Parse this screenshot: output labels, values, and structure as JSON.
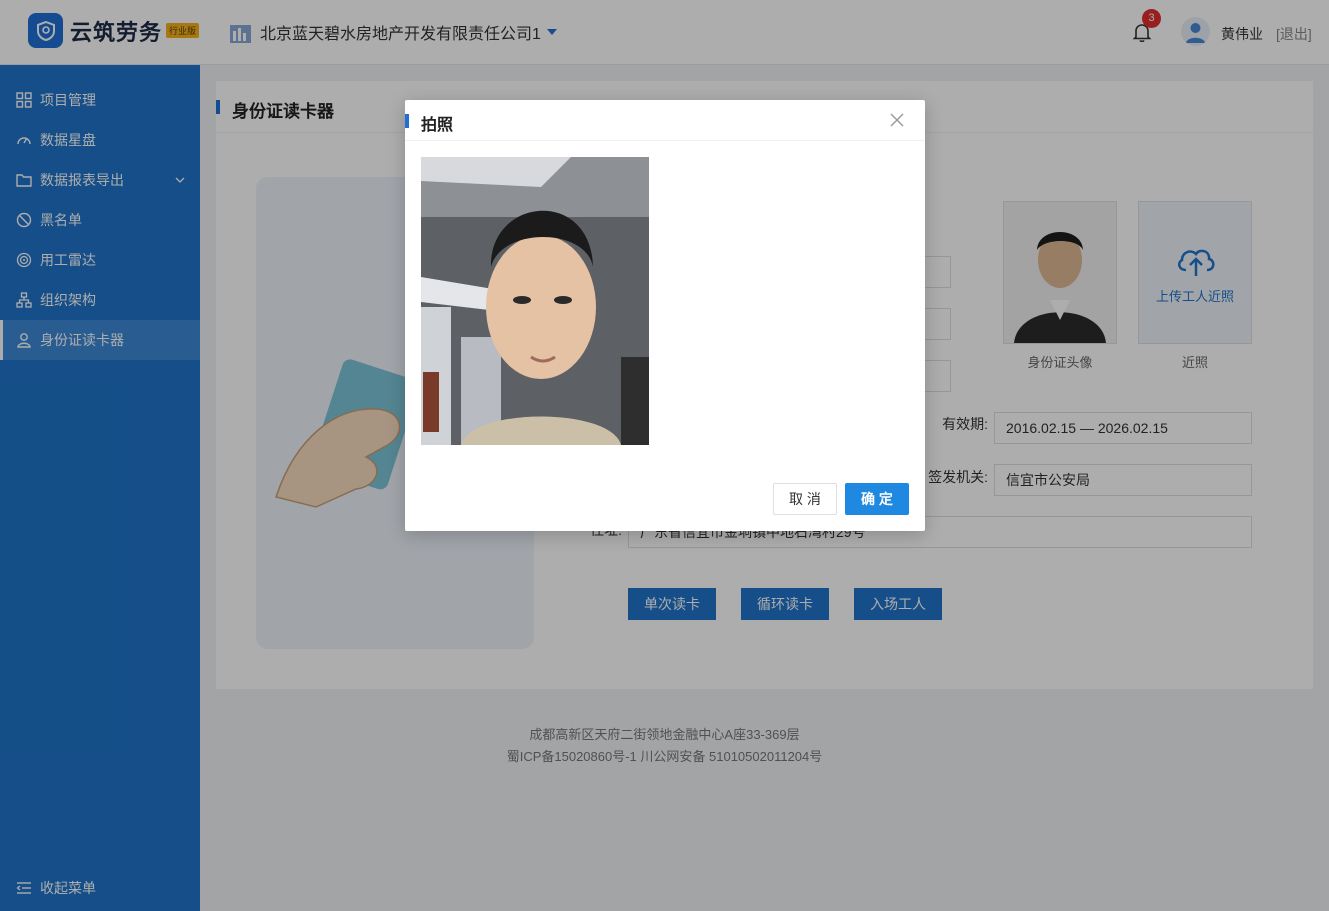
{
  "header": {
    "brand": "云筑劳务",
    "brand_badge": "行业版",
    "company": "北京蓝天碧水房地产开发有限责任公司1",
    "notification_count": "3",
    "username": "黄伟业",
    "logout": "[退出]"
  },
  "sidebar": {
    "items": [
      {
        "label": "项目管理",
        "icon": "grid-icon"
      },
      {
        "label": "数据星盘",
        "icon": "dashboard-icon"
      },
      {
        "label": "数据报表导出",
        "icon": "folder-icon"
      },
      {
        "label": "黑名单",
        "icon": "ban-icon"
      },
      {
        "label": "用工雷达",
        "icon": "radar-icon"
      },
      {
        "label": "组织架构",
        "icon": "org-icon"
      },
      {
        "label": "身份证读卡器",
        "icon": "person-icon"
      }
    ],
    "collapse": "收起菜单",
    "active_index": 6
  },
  "page": {
    "title": "身份证读卡器",
    "validity_label": "有效期:",
    "validity_value": "2016.02.15 — 2026.02.15",
    "issuer_label": "签发机关:",
    "issuer_value": "信宜市公安局",
    "address_label": "住址:",
    "address_value": "广东省信宜市金垌镇中地石湾村29号",
    "id_photo_caption": "身份证头像",
    "recent_photo_caption": "近照",
    "upload_text": "上传工人近照",
    "buttons": {
      "single_read": "单次读卡",
      "loop_read": "循环读卡",
      "enter_worker": "入场工人"
    }
  },
  "footer": {
    "address": "成都高新区天府二街领地金融中心A座33-369层",
    "icp": "蜀ICP备15020860号-1 川公网安备 51010502011204号"
  },
  "modal": {
    "title": "拍照",
    "cancel": "取 消",
    "confirm": "确 定"
  },
  "colors": {
    "sidebar": "#1f74c9",
    "primary": "#1f88e0",
    "accent_bar": "#1f6fd6",
    "badge": "#e02f2f"
  }
}
